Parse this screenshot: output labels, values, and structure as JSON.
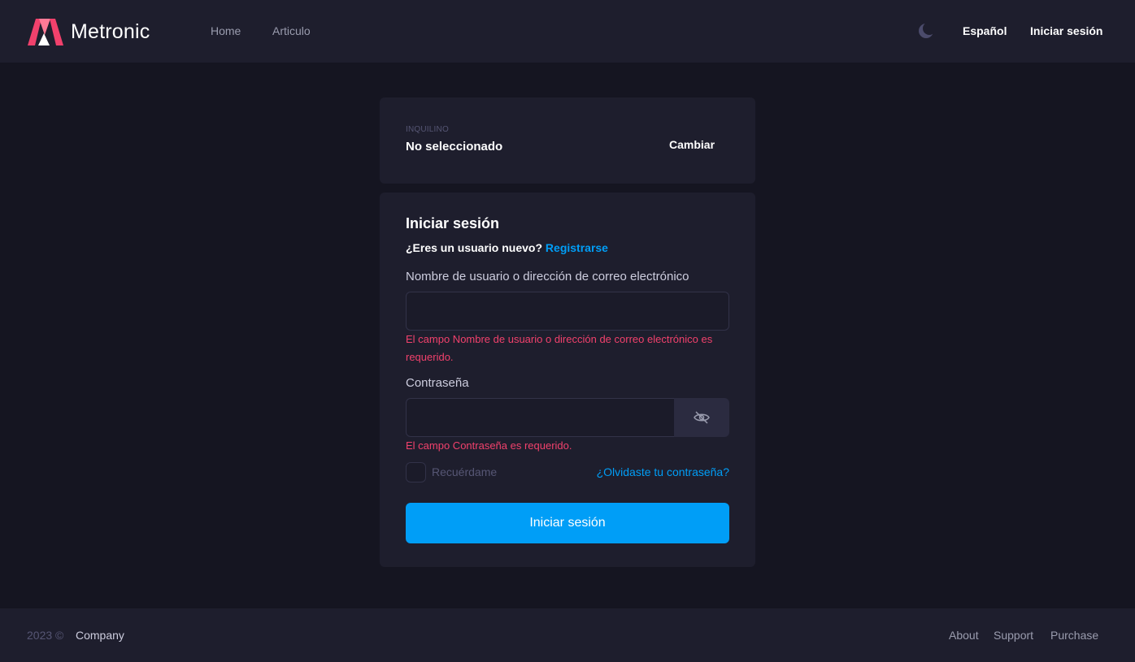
{
  "header": {
    "brand": "Metronic",
    "nav": [
      "Home",
      "Articulo"
    ],
    "language": "Español",
    "login_link": "Iniciar sesión"
  },
  "tenant": {
    "label": "INQUILINO",
    "value": "No seleccionado",
    "change": "Cambiar"
  },
  "login": {
    "title": "Iniciar sesión",
    "new_user_prompt": "¿Eres un usuario nuevo?",
    "register_link": "Registrarse",
    "username_label": "Nombre de usuario o dirección de correo electrónico",
    "username_value": "",
    "username_error": "El campo Nombre de usuario o dirección de correo electrónico es requerido.",
    "password_label": "Contraseña",
    "password_value": "",
    "password_error": "El campo Contraseña es requerido.",
    "remember_label": "Recuérdame",
    "forgot_link": "¿Olvidaste tu contraseña?",
    "submit_label": "Iniciar sesión"
  },
  "footer": {
    "copyright": "2023 ©",
    "company": "Company",
    "links": [
      "About",
      "Support",
      "Purchase"
    ]
  },
  "colors": {
    "background": "#151521",
    "surface": "#1e1e2d",
    "accent": "#009ef7",
    "error": "#f1416c",
    "brand": "#f1416c"
  },
  "icons": {
    "logo": "metronic-logo-icon",
    "theme": "moon-icon",
    "password_visibility": "eye-slash-icon"
  }
}
